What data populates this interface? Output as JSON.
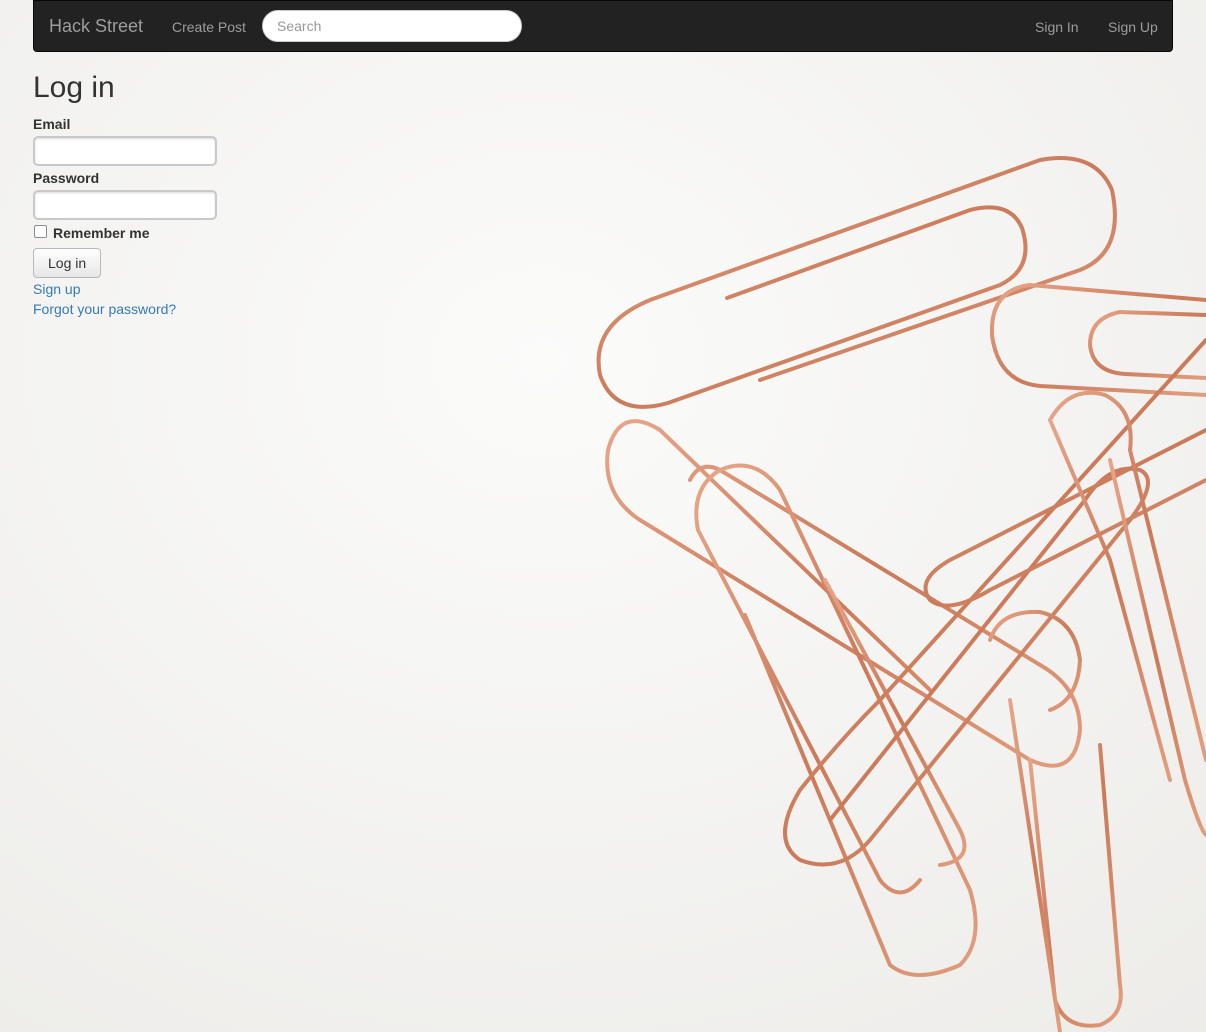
{
  "navbar": {
    "brand": "Hack Street",
    "create_post": "Create Post",
    "search_placeholder": "Search",
    "sign_in": "Sign In",
    "sign_up": "Sign Up"
  },
  "login": {
    "title": "Log in",
    "email_label": "Email",
    "email_value": "",
    "password_label": "Password",
    "password_value": "",
    "remember_label": "Remember me",
    "remember_checked": false,
    "submit_label": "Log in",
    "sign_up_link": "Sign up",
    "forgot_link": "Forgot your password?"
  },
  "background": {
    "subject": "paper-clips-image",
    "paper_color": "#f4f4f2",
    "clip_color": "#d58a68"
  },
  "colors": {
    "navbar_bg": "#222222",
    "nav_text": "#9d9d9d",
    "link": "#337ab7"
  }
}
